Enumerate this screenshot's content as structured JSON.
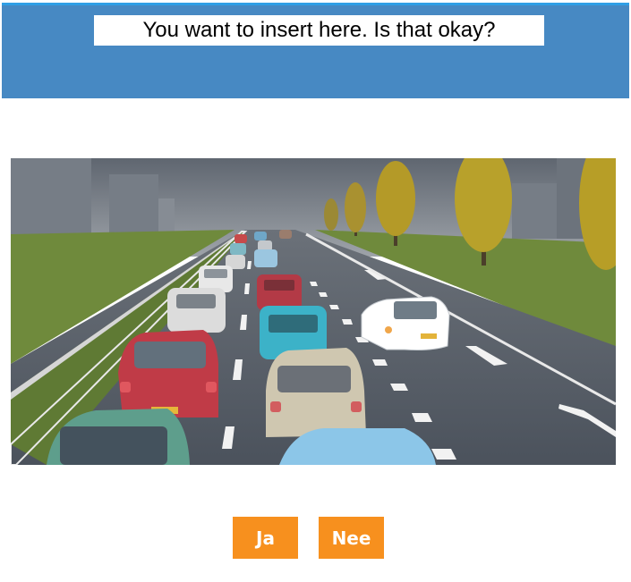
{
  "header": {
    "question": "You want to insert here. Is that okay?"
  },
  "scene": {
    "icon": "traffic-jam-highway-illustration"
  },
  "buttons": {
    "yes_label": "Ja",
    "no_label": "Nee"
  },
  "colors": {
    "header_bg": "#4789c3",
    "button_bg": "#f7901e",
    "button_text": "#ffffff"
  }
}
